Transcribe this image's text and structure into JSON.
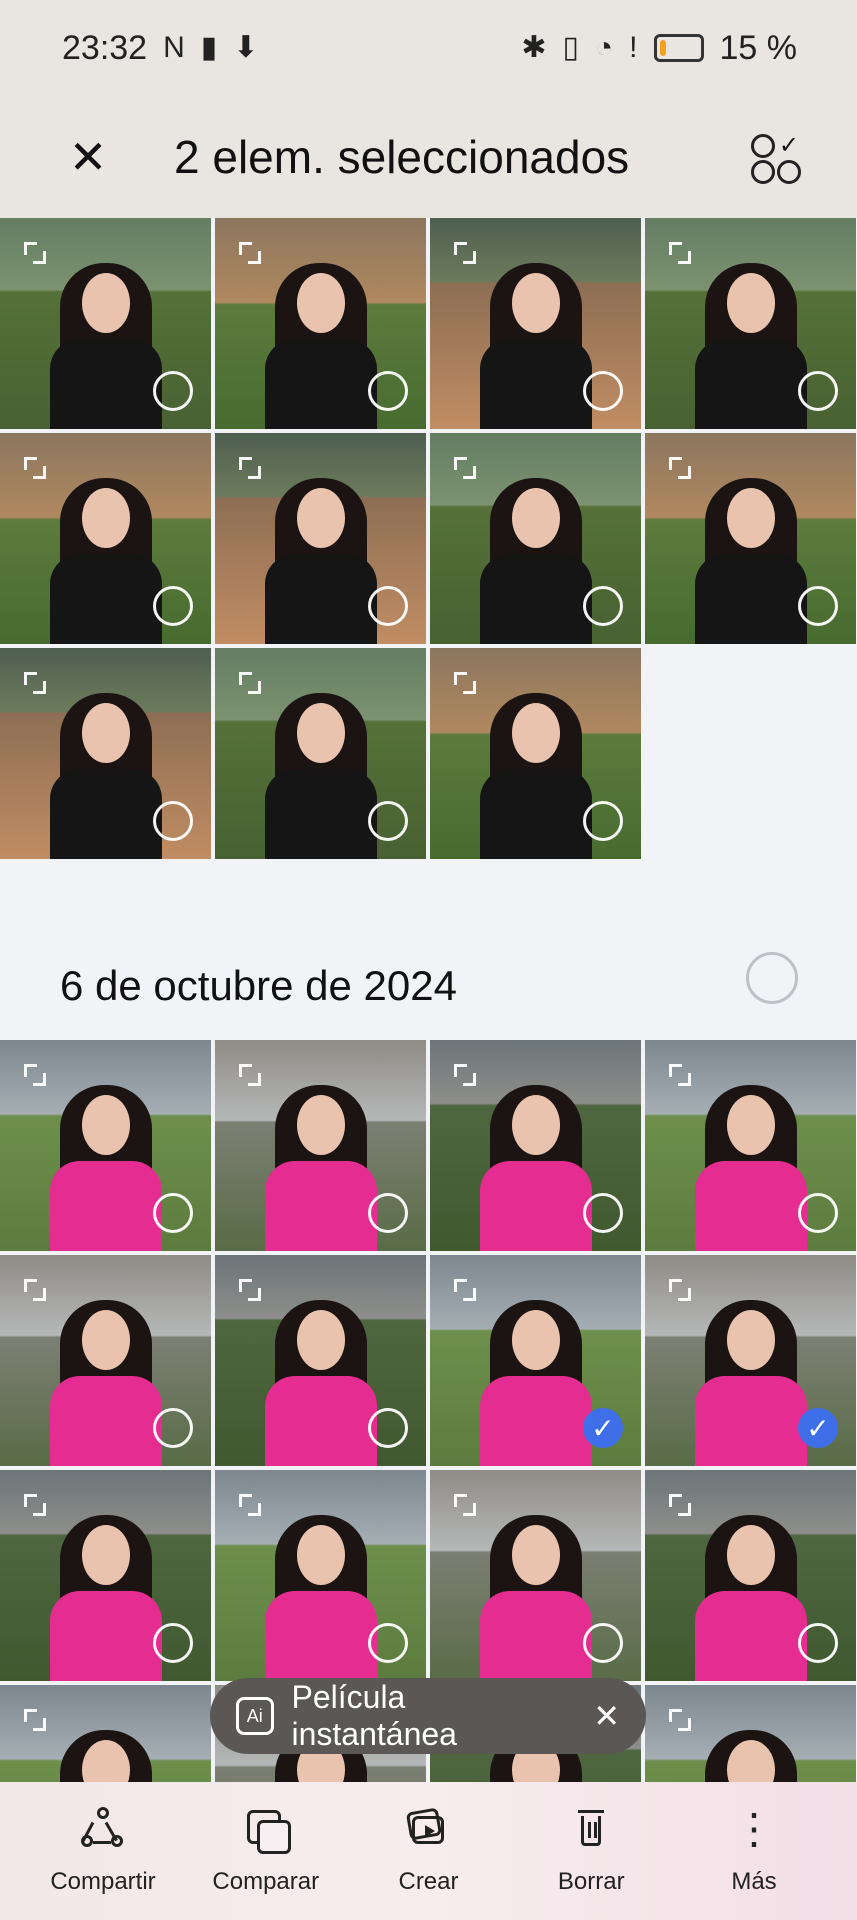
{
  "status_bar": {
    "time": "23:32",
    "battery_percent": "15 %",
    "battery_level": 0.15,
    "icons": [
      "nfc-icon",
      "battery-alert-icon",
      "download-icon",
      "bluetooth-icon",
      "vibration-icon",
      "wifi-icon",
      "alert-icon",
      "battery-icon"
    ]
  },
  "header": {
    "title": "2 elem. seleccionados",
    "close_icon": "close-icon",
    "select_all_icon": "select-all-icon"
  },
  "sections": {
    "date": "6 de octubre de 2024"
  },
  "toast": {
    "label": "Película instantánea",
    "ai_icon": "ai-icon",
    "close_icon": "close-icon"
  },
  "bottom_bar": {
    "actions": [
      {
        "label": "Compartir",
        "icon": "share-icon"
      },
      {
        "label": "Comparar",
        "icon": "compare-icon"
      },
      {
        "label": "Crear",
        "icon": "create-icon"
      },
      {
        "label": "Borrar",
        "icon": "trash-icon"
      },
      {
        "label": "Más",
        "icon": "more-icon"
      }
    ]
  },
  "colors": {
    "selected_blue": "#3f6fe8",
    "toolbar_bg": "#e9e6e1",
    "pink_outfit": "#e52c90",
    "black_outfit": "#151515"
  },
  "gallery": {
    "upper_rows": [
      [
        {
          "outfit": "black",
          "selected": false
        },
        {
          "outfit": "black",
          "selected": false
        },
        {
          "outfit": "black",
          "selected": false
        },
        {
          "outfit": "black",
          "selected": false
        }
      ],
      [
        {
          "outfit": "black",
          "selected": false
        },
        {
          "outfit": "black",
          "selected": false
        },
        {
          "outfit": "black",
          "selected": false
        },
        {
          "outfit": "black",
          "selected": false
        }
      ],
      [
        {
          "outfit": "black",
          "selected": false
        },
        {
          "outfit": "black",
          "selected": false
        },
        {
          "outfit": "black",
          "selected": false
        }
      ]
    ],
    "lower_rows": [
      [
        {
          "outfit": "pink",
          "selected": false
        },
        {
          "outfit": "pink",
          "selected": false
        },
        {
          "outfit": "pink",
          "selected": false
        },
        {
          "outfit": "pink",
          "selected": false
        }
      ],
      [
        {
          "outfit": "pink",
          "selected": false
        },
        {
          "outfit": "pink",
          "selected": false
        },
        {
          "outfit": "pink",
          "selected": true
        },
        {
          "outfit": "pink",
          "selected": true
        }
      ],
      [
        {
          "outfit": "pink",
          "selected": false
        },
        {
          "outfit": "pink",
          "selected": false
        },
        {
          "outfit": "pink",
          "selected": false
        },
        {
          "outfit": "pink",
          "selected": false
        }
      ],
      [
        {
          "outfit": "pink",
          "selected": false
        },
        {
          "outfit": "pink",
          "selected": false
        },
        {
          "outfit": "pink",
          "selected": false
        },
        {
          "outfit": "pink",
          "selected": false
        }
      ]
    ]
  }
}
